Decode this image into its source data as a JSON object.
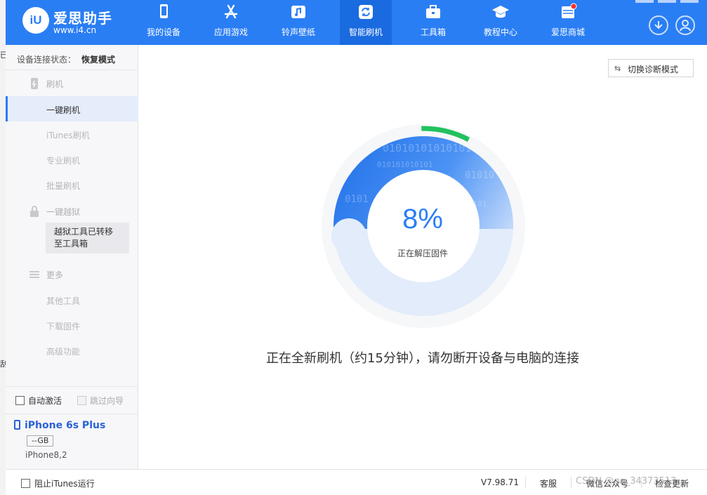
{
  "app": {
    "logo_text": "iU",
    "title": "爱思助手",
    "url": "www.i4.cn"
  },
  "nav": [
    {
      "label": "我的设备",
      "icon": "phone-icon"
    },
    {
      "label": "应用游戏",
      "icon": "appstore-icon"
    },
    {
      "label": "铃声壁纸",
      "icon": "music-icon"
    },
    {
      "label": "智能刷机",
      "icon": "refresh-icon",
      "active": true
    },
    {
      "label": "工具箱",
      "icon": "toolbox-icon"
    },
    {
      "label": "教程中心",
      "icon": "graduation-cap-icon"
    },
    {
      "label": "爱思商城",
      "icon": "store-icon",
      "badge": true
    }
  ],
  "sidebar": {
    "status_label": "设备连接状态：",
    "status_value": "恢复模式",
    "groups": {
      "flash": "刷机",
      "jailbreak": "一键越狱",
      "more": "更多"
    },
    "items": {
      "one_click_flash": "一键刷机",
      "itunes_flash": "iTunes刷机",
      "pro_flash": "专业刷机",
      "batch_flash": "批量刷机",
      "other_tools": "其他工具",
      "download_firmware": "下载固件",
      "advanced": "高级功能"
    },
    "tooltip": "越狱工具已转移至工具箱",
    "auto_activate": "自动激活",
    "skip_guide": "跳过向导",
    "device": {
      "name": "iPhone 6s Plus",
      "capacity": "--GB",
      "model": "iPhone8,2"
    }
  },
  "main": {
    "diag_button": "切换诊断模式",
    "progress_text": "8%",
    "progress_value": 0.08,
    "sub_status": "正在解压固件",
    "message": "正在全新刷机（约15分钟），请勿断开设备与电脑的连接"
  },
  "bottom": {
    "block_itunes": "阻止iTunes运行",
    "version": "V7.98.71",
    "support": "客服",
    "wechat": "微信公众号",
    "check_update": "检查更新",
    "watermark": "CSDN @qq_34373513"
  },
  "colors": {
    "brand": "#2a7ef4",
    "progress": "#21c25e",
    "active_bg": "#e5edfb"
  }
}
